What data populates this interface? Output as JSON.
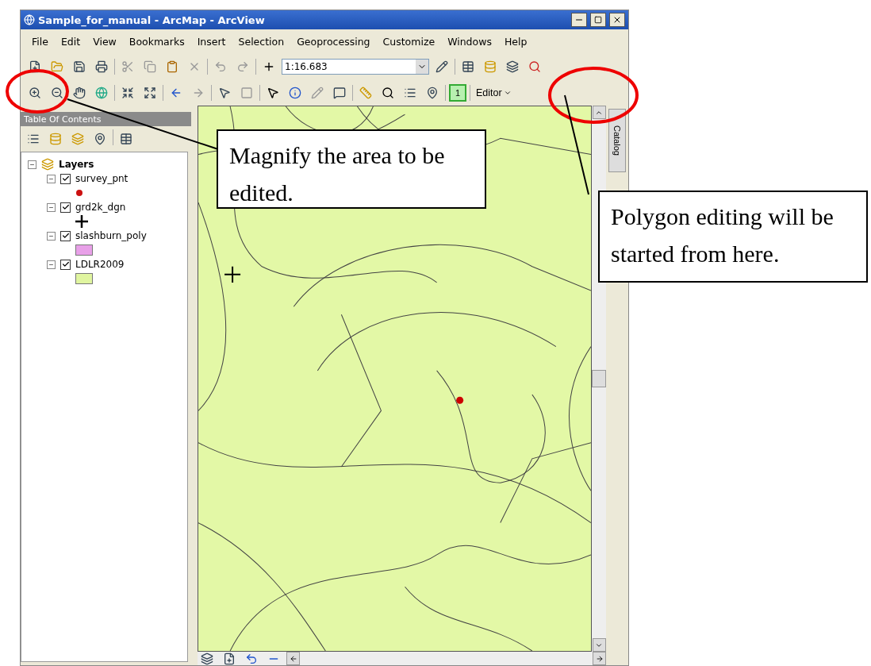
{
  "window": {
    "title": "Sample_for_manual - ArcMap - ArcView"
  },
  "menu": [
    "File",
    "Edit",
    "View",
    "Bookmarks",
    "Insert",
    "Selection",
    "Geoprocessing",
    "Customize",
    "Windows",
    "Help"
  ],
  "toolbar": {
    "scale": "1:16.683",
    "layout_page": "1",
    "editor": "Editor"
  },
  "toc": {
    "title": "Table Of Contents",
    "root": {
      "name": "Layers",
      "expanded": true,
      "children": [
        {
          "name": "survey_pnt",
          "checked": true,
          "expanded": true,
          "kind": "point",
          "color": "#cc1111"
        },
        {
          "name": "grd2k_dgn",
          "checked": true,
          "expanded": true,
          "kind": "cross",
          "color": "#000000"
        },
        {
          "name": "slashburn_poly",
          "checked": true,
          "expanded": true,
          "kind": "fill",
          "color": "#e8a0e8"
        },
        {
          "name": "LDLR2009",
          "checked": true,
          "expanded": true,
          "kind": "fill",
          "color": "#e0f5a0"
        }
      ]
    }
  },
  "catalog_tab": "Catalog",
  "callouts": [
    {
      "text": "Magnify the area to be edited."
    },
    {
      "text": "Polygon editing will be started from here."
    }
  ]
}
